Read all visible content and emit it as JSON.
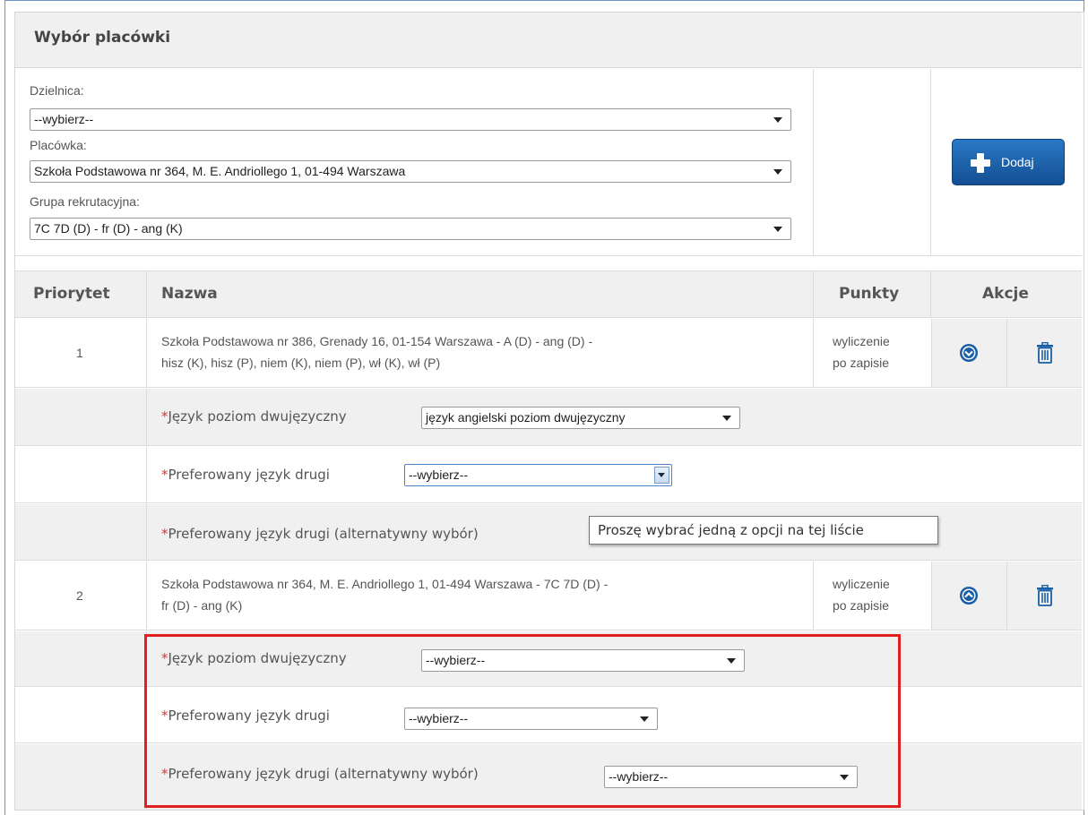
{
  "section": {
    "title": "Wybór placówki"
  },
  "filters": {
    "district_label": "Dzielnica:",
    "district_value": "--wybierz--",
    "school_label": "Placówka:",
    "school_value": "Szkoła Podstawowa nr 364, M. E. Andriollego 1, 01-494 Warszawa",
    "group_label": "Grupa rekrutacyjna:",
    "group_value": "7C 7D (D) - fr (D) - ang (K)"
  },
  "add_button": {
    "label": "Dodaj"
  },
  "table": {
    "headers": {
      "priority": "Priorytet",
      "name": "Nazwa",
      "points": "Punkty",
      "actions": "Akcje"
    },
    "rows": [
      {
        "priority": "1",
        "name_line1": "Szkoła Podstawowa nr 386, Grenady 16, 01-154 Warszawa - A (D) - ang (D) -",
        "name_line2": "hisz (K), hisz (P), niem (K), niem (P), wł (K), wł (P)",
        "points_line1": "wyliczenie",
        "points_line2": "po zapisie",
        "fields": [
          {
            "required": "*",
            "label": "Język poziom dwujęzyczny",
            "value": "język angielski poziom dwujęzyczny"
          },
          {
            "required": "*",
            "label": "Preferowany język drugi",
            "value": "--wybierz--"
          },
          {
            "required": "*",
            "label": "Preferowany język drugi (alternatywny wybór)",
            "tooltip": "Proszę wybrać jedną z opcji na tej liście"
          }
        ]
      },
      {
        "priority": "2",
        "name_line1": "Szkoła Podstawowa nr 364, M. E. Andriollego 1, 01-494 Warszawa - 7C 7D (D) -",
        "name_line2": "fr (D) - ang (K)",
        "points_line1": "wyliczenie",
        "points_line2": "po zapisie",
        "fields": [
          {
            "required": "*",
            "label": "Język poziom dwujęzyczny",
            "value": "--wybierz--"
          },
          {
            "required": "*",
            "label": "Preferowany język drugi",
            "value": "--wybierz--"
          },
          {
            "required": "*",
            "label": "Preferowany język drugi (alternatywny wybór)",
            "value": "--wybierz--"
          }
        ]
      }
    ]
  },
  "icons": {
    "move": "chevron-circle-icon",
    "delete": "trash-icon"
  },
  "colors": {
    "accent": "#1a5fa6",
    "required": "#e03333",
    "highlight": "#e02020"
  }
}
